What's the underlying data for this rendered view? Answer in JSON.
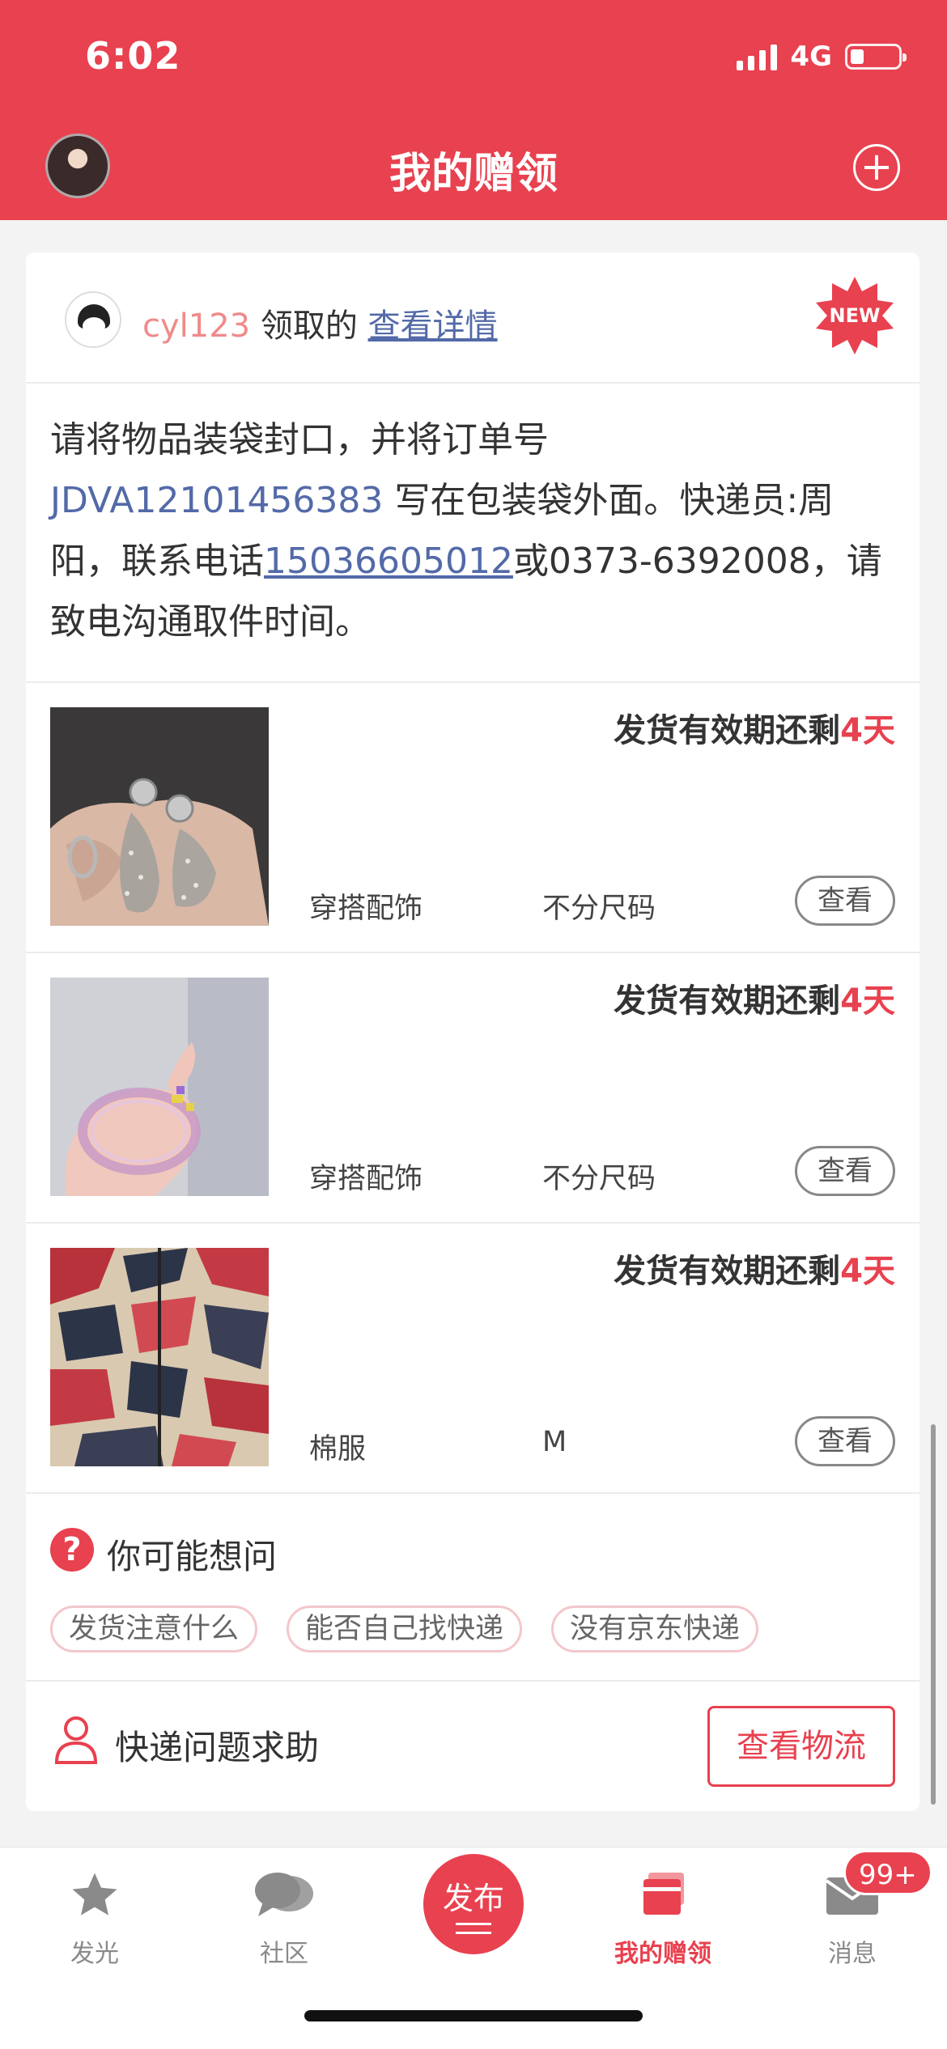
{
  "status_bar": {
    "time": "6:02",
    "network": "4G"
  },
  "header": {
    "title": "我的赠领"
  },
  "claim": {
    "username": "cyl123",
    "claimed_text": " 领取的 ",
    "details_link": "查看详情",
    "new_badge": "NEW"
  },
  "notice": {
    "text_before": "请将物品装袋封口，并将订单号 ",
    "order_no": "JDVA12101456383",
    "text_middle": " 写在包装袋外面。快递员:周阳，联系电话",
    "phone": "15036605012",
    "text_after": "或0373-6392008，请致电沟通取件时间。"
  },
  "items": [
    {
      "deadline_label": "发货有效期还剩",
      "deadline_days": "4天",
      "category": "穿搭配饰",
      "size": "不分尺码",
      "button": "查看",
      "image": "earrings-photo"
    },
    {
      "deadline_label": "发货有效期还剩",
      "deadline_days": "4天",
      "category": "穿搭配饰",
      "size": "不分尺码",
      "button": "查看",
      "image": "bracelet-photo"
    },
    {
      "deadline_label": "发货有效期还剩",
      "deadline_days": "4天",
      "category": "棉服",
      "size": "M",
      "button": "查看",
      "image": "camo-jacket-photo"
    }
  ],
  "faq": {
    "icon": "?",
    "title": "你可能想问",
    "tags": [
      "发货注意什么",
      "能否自己找快递",
      "没有京东快递"
    ]
  },
  "help": {
    "label": "快递问题求助",
    "button": "查看物流"
  },
  "tabbar": {
    "tabs": [
      {
        "label": "发光",
        "icon": "star-icon"
      },
      {
        "label": "社区",
        "icon": "chat-bubble-icon"
      },
      {
        "label": "发布",
        "icon": "publish-icon"
      },
      {
        "label": "我的赠领",
        "icon": "gift-stack-icon",
        "active": true
      },
      {
        "label": "消息",
        "icon": "envelope-icon"
      }
    ],
    "message_badge": "99+"
  },
  "colors": {
    "brand": "#e8414f",
    "link": "#536aa8",
    "username": "#f08a8a"
  }
}
